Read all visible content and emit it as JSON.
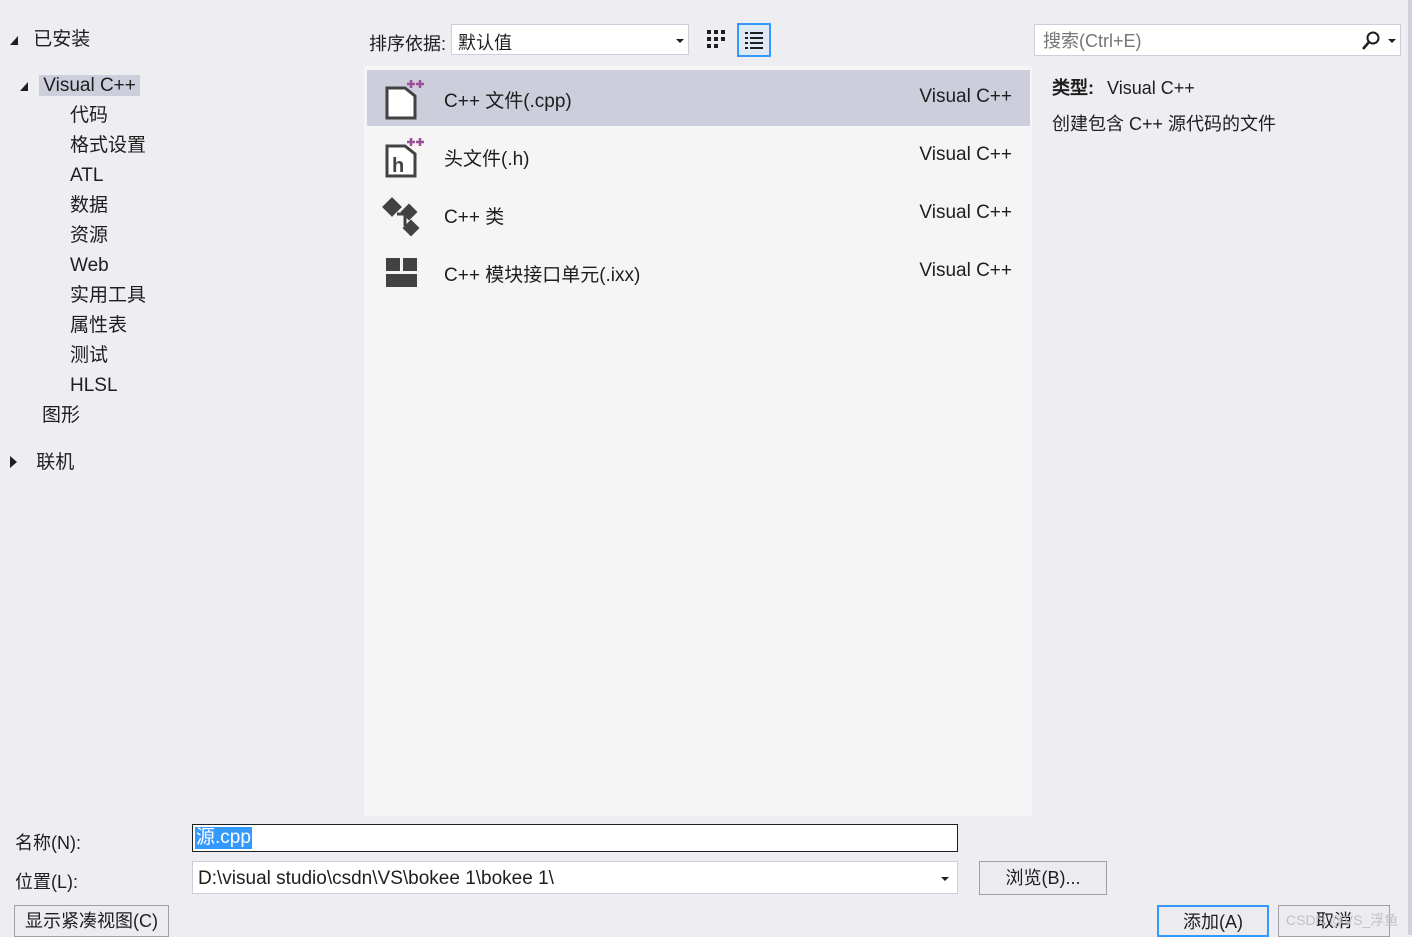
{
  "tree": {
    "installed_label": "已安装",
    "visualcpp_label": "Visual C++",
    "children": [
      "代码",
      "格式设置",
      "ATL",
      "数据",
      "资源",
      "Web",
      "实用工具",
      "属性表",
      "测试",
      "HLSL"
    ],
    "graphics_label": "图形",
    "online_label": "联机"
  },
  "toolbar": {
    "sort_label": "排序依据:",
    "sort_value": "默认值"
  },
  "search": {
    "placeholder": "搜索(Ctrl+E)"
  },
  "templates": [
    {
      "name": "C++ 文件(.cpp)",
      "lang": "Visual C++",
      "icon": "cpp-file-icon"
    },
    {
      "name": "头文件(.h)",
      "lang": "Visual C++",
      "icon": "header-file-icon"
    },
    {
      "name": "C++ 类",
      "lang": "Visual C++",
      "icon": "cpp-class-icon"
    },
    {
      "name": "C++ 模块接口单元(.ixx)",
      "lang": "Visual C++",
      "icon": "module-interface-icon"
    }
  ],
  "description": {
    "type_label": "类型:",
    "type_value": "Visual C++",
    "text": "创建包含 C++ 源代码的文件"
  },
  "form": {
    "name_label": "名称(N):",
    "name_value": "源.cpp",
    "location_label": "位置(L):",
    "location_value": "D:\\visual studio\\csdn\\VS\\bokee 1\\bokee 1\\",
    "browse_label": "浏览(B)...",
    "compact_label": "显示紧凑视图(C)",
    "add_label": "添加(A)",
    "cancel_label": "取消"
  },
  "watermark": "CSDN @VS_浮鱼",
  "colors": {
    "accent": "#3399ff",
    "selection": "#cccedb",
    "plus_purple": "#9b4f96",
    "icon_dark": "#424242"
  }
}
